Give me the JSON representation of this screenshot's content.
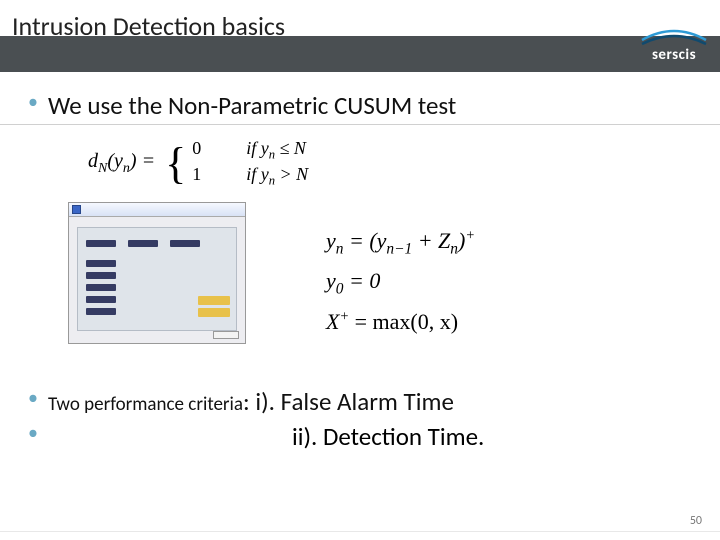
{
  "header": {
    "title": "Intrusion Detection basics",
    "logo_text": "serscis"
  },
  "bullets": {
    "main": "We use the Non-Parametric CUSUM test",
    "criteria_prefix": "Two performance criteria",
    "criteria_i": ": i). False Alarm Time",
    "criteria_ii": "ii). Detection Time."
  },
  "formulas": {
    "dn_lhs": "d",
    "dn_sub": "N",
    "dn_arg_open": "(",
    "dn_arg": "y",
    "dn_arg_sub": "n",
    "dn_arg_close": ") =",
    "case0_val": "0",
    "case0_cond_if": "if  ",
    "case0_cond": "y",
    "case0_cond_sub": "n",
    "case0_cond_rel": " ≤ N",
    "case1_val": "1",
    "case1_cond_if": "if  ",
    "case1_cond": "y",
    "case1_cond_sub": "n",
    "case1_cond_rel": " > N",
    "yn": "y",
    "yn_sub": "n",
    "yn_eq": " = (y",
    "yn_prev_sub": "n−1",
    "yn_plus": " + Z",
    "zn_sub": "n",
    "yn_close": ")",
    "yn_sup": "+",
    "y0": "y",
    "y0_sub": "0",
    "y0_eq": " = 0",
    "xplus": "X",
    "xplus_sup": "+",
    "xplus_eq": " = max(0, x)"
  },
  "page_number": "50"
}
